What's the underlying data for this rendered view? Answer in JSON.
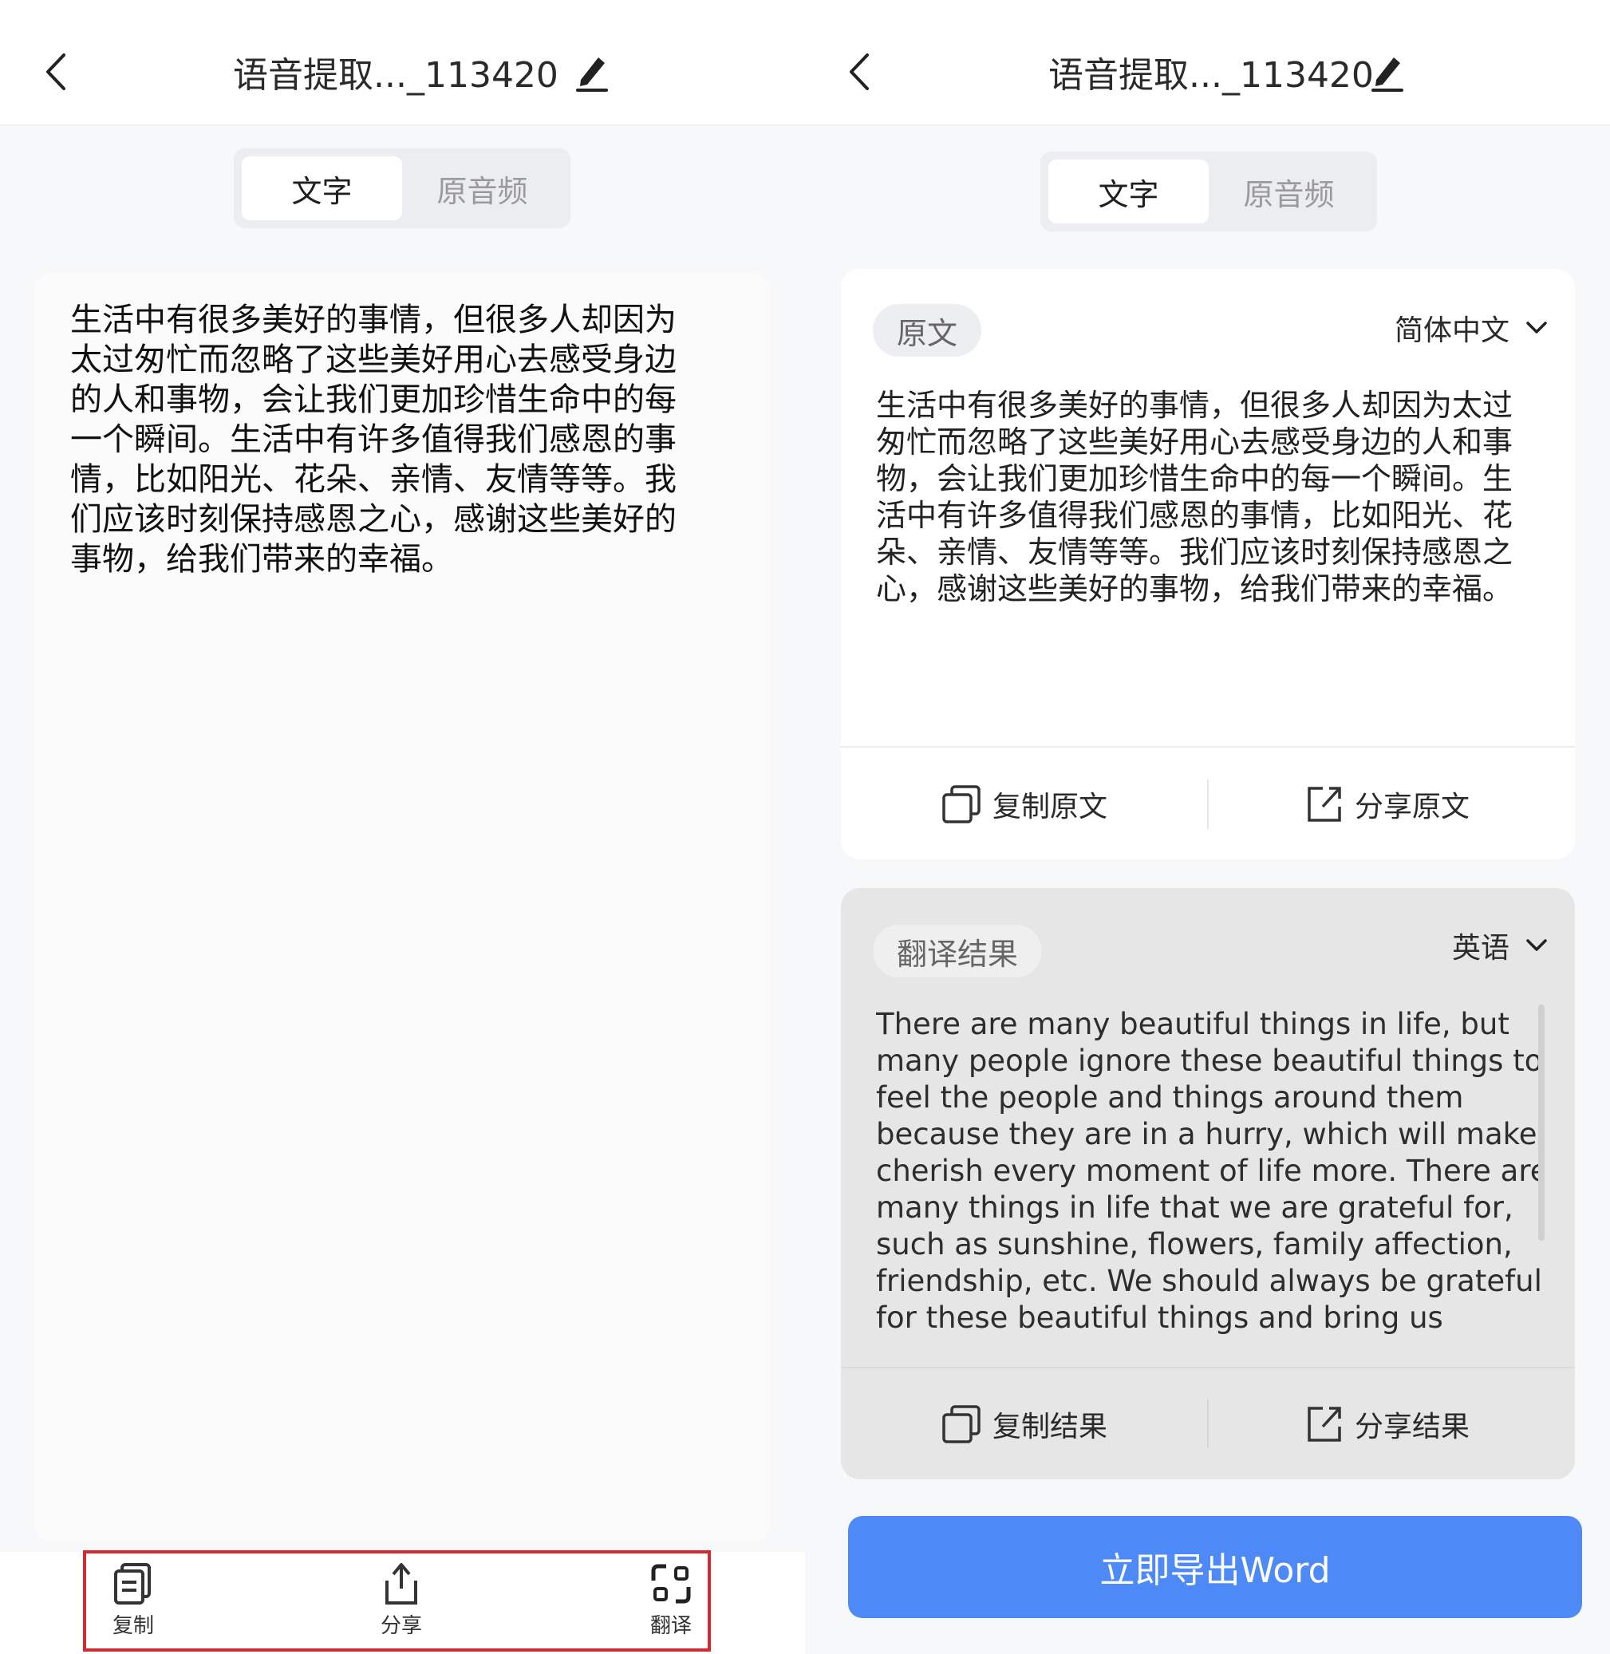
{
  "title": "语音提取..._113420",
  "tabs": {
    "text": "文字",
    "audio": "原音频"
  },
  "left": {
    "body_lines": [
      "生活中有很多美好的事情，但很多人却因为",
      "太过匆忙而忽略了这些美好用心去感受身边",
      "的人和事物，会让我们更加珍惜生命中的每",
      "一个瞬间。生活中有许多值得我们感恩的事",
      "情，比如阳光、花朵、亲情、友情等等。我",
      "们应该时刻保持感恩之心，感谢这些美好的",
      "事物，给我们带来的幸福。"
    ],
    "toolbar": {
      "copy": "复制",
      "share": "分享",
      "translate": "翻译"
    }
  },
  "right": {
    "original": {
      "pill": "原文",
      "language": "简体中文",
      "lines": [
        "生活中有很多美好的事情，但很多人却因为太过",
        "匆忙而忽略了这些美好用心去感受身边的人和事",
        "物，会让我们更加珍惜生命中的每一个瞬间。生",
        "活中有许多值得我们感恩的事情，比如阳光、花",
        "朵、亲情、友情等等。我们应该时刻保持感恩之",
        "心，感谢这些美好的事物，给我们带来的幸福。"
      ],
      "copy": "复制原文",
      "share": "分享原文"
    },
    "translation": {
      "pill": "翻译结果",
      "language": "英语",
      "lines": [
        "There are many beautiful things in life, but",
        "many people ignore these beautiful things to",
        "feel the people and things around them",
        "because they are in a hurry, which will make us",
        "cherish every moment of life more. There are",
        "many things in life that we are grateful for,",
        "such as sunshine, flowers, family affection,",
        "friendship, etc. We should always be grateful",
        "for these beautiful things and bring us"
      ],
      "copy": "复制结果",
      "share": "分享结果"
    },
    "export_button": "立即导出Word"
  },
  "colors": {
    "accent": "#4e8af7",
    "highlight": "#d8282f",
    "background": "#f7f8fa"
  }
}
